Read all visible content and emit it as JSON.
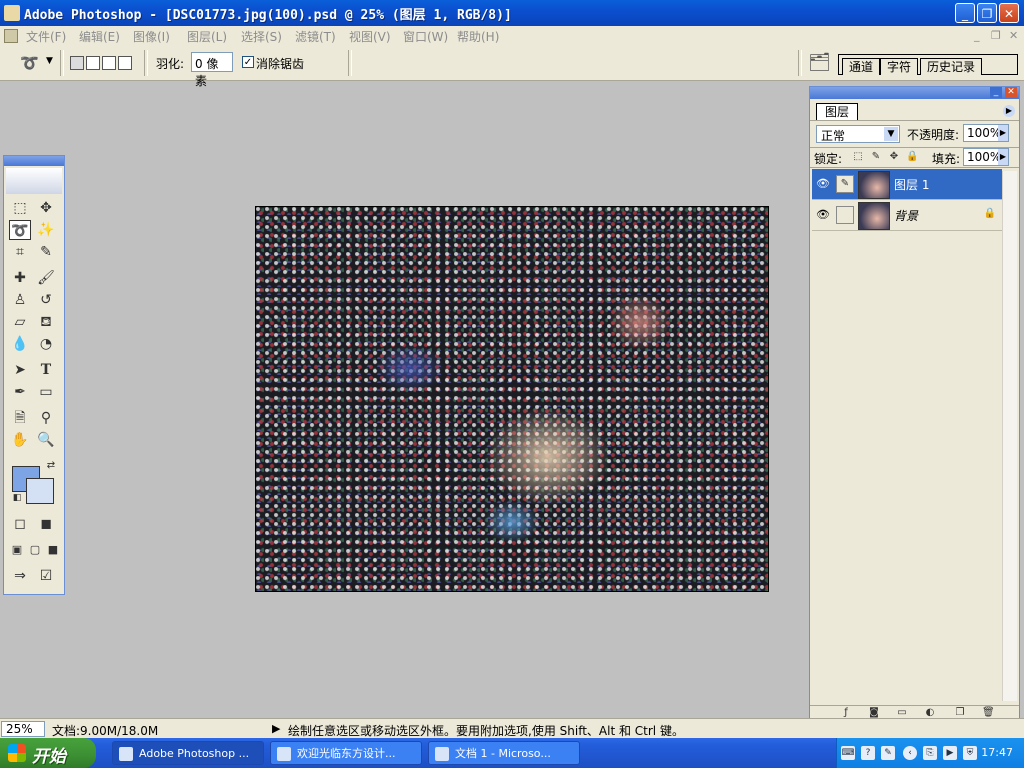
{
  "window": {
    "title": "Adobe Photoshop - [DSC01773.jpg(100).psd @ 25% (图层 1, RGB/8)]",
    "minimize": "_",
    "restore": "❐",
    "close": "✕"
  },
  "menu": {
    "items": [
      "文件(F)",
      "编辑(E)",
      "图像(I)",
      "图层(L)",
      "选择(S)",
      "滤镜(T)",
      "视图(V)",
      "窗口(W)",
      "帮助(H)"
    ]
  },
  "options": {
    "feather_label": "羽化:",
    "feather_value": "0 像素",
    "antialias_label": "消除锯齿",
    "antialias_checked": "✓",
    "well_tabs": [
      "通道",
      "字符",
      "历史记录"
    ]
  },
  "layers_panel": {
    "tab": "图层",
    "blend_mode": "正常",
    "opacity_label": "不透明度:",
    "opacity_value": "100%",
    "lock_label": "锁定:",
    "fill_label": "填充:",
    "fill_value": "100%",
    "layers": [
      {
        "name": "图层 1",
        "selected": true
      },
      {
        "name": "背景",
        "selected": false,
        "locked": true
      }
    ]
  },
  "status": {
    "zoom": "25%",
    "doc_size": "文档:9.00M/18.0M",
    "hint": "绘制任意选区或移动选区外框。要用附加选项,使用 Shift、Alt 和 Ctrl 键。"
  },
  "taskbar": {
    "start": "开始",
    "tasks": [
      "Adobe Photoshop ...",
      "欢迎光临东方设计...",
      "文档 1 - Microso..."
    ],
    "clock": "17:47"
  },
  "colors": {
    "foreground": "#7da4e4",
    "background": "#d4e0f4",
    "selection": "#316ac5"
  }
}
